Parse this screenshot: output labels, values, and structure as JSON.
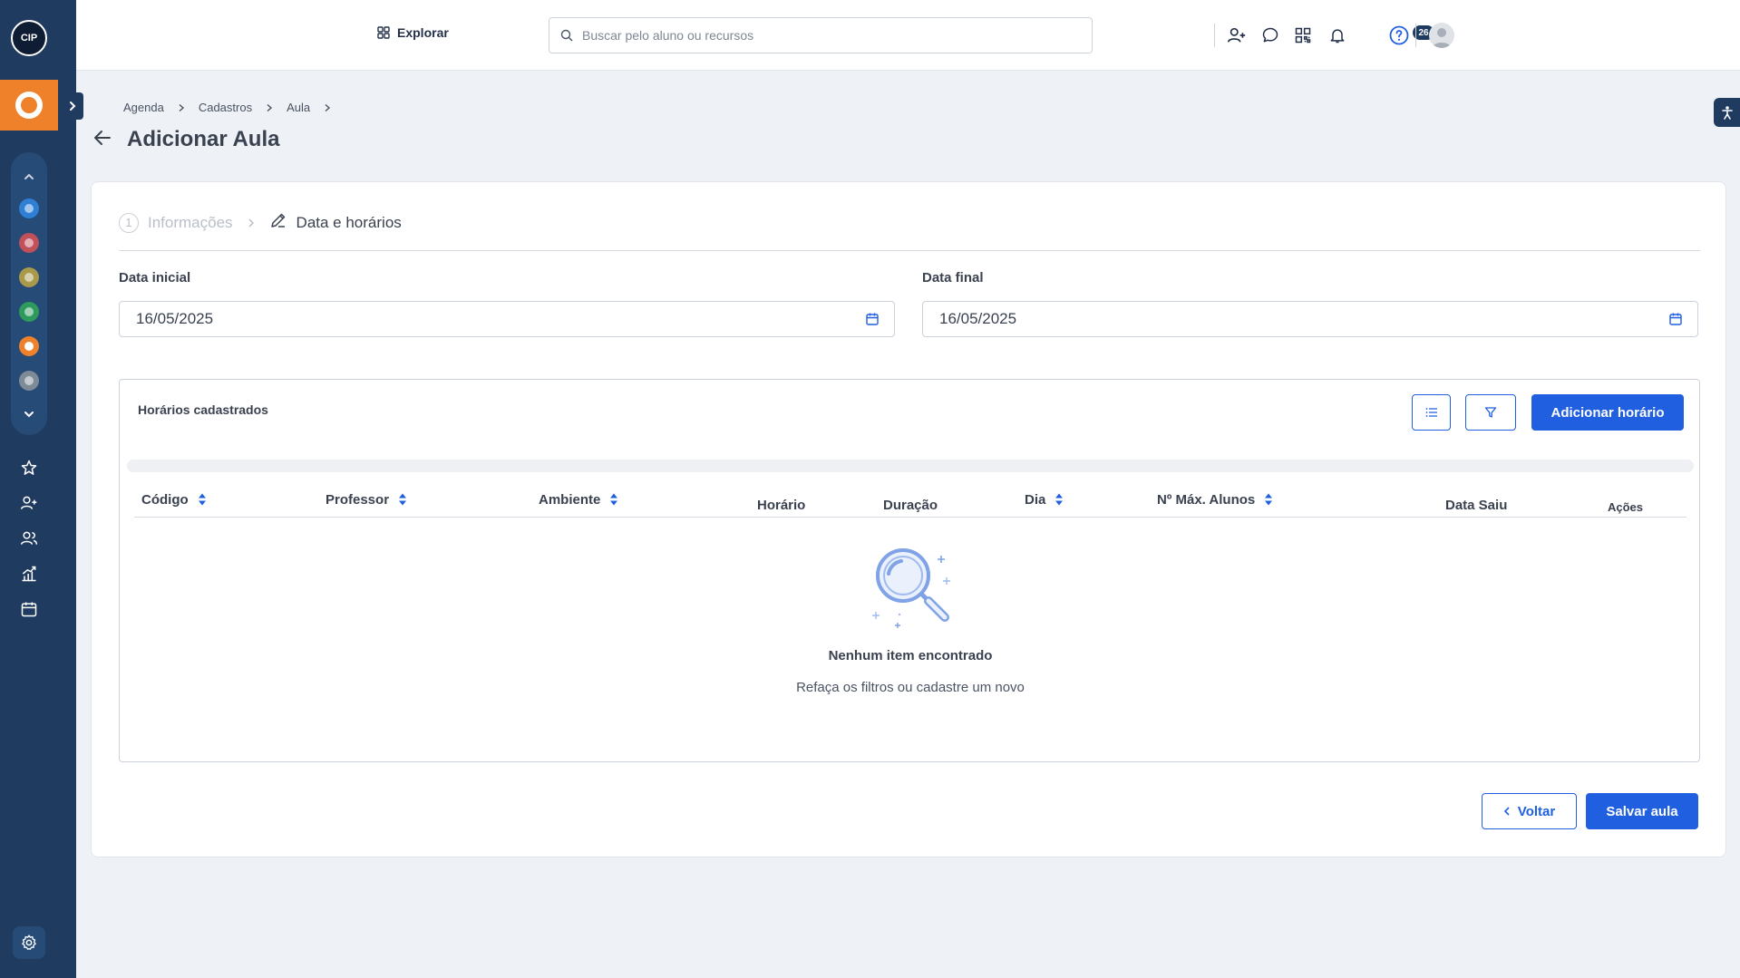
{
  "sidebar": {
    "logo_text": "CIP",
    "apps": [
      {
        "name": "app-blue",
        "color": "#2f7fd4"
      },
      {
        "name": "app-red",
        "color": "#c0505a"
      },
      {
        "name": "app-olive",
        "color": "#a89a4a"
      },
      {
        "name": "app-green",
        "color": "#2f9a5e"
      },
      {
        "name": "app-orange",
        "color": "#f0812b"
      },
      {
        "name": "app-gray",
        "color": "#7f8a99"
      }
    ],
    "nav_icons": [
      "star-icon",
      "add-user-icon",
      "users-icon",
      "chart-icon",
      "calendar-icon"
    ]
  },
  "topbar": {
    "explore_label": "Explorar",
    "search_placeholder": "Buscar pelo aluno ou recursos",
    "notification_count": "26"
  },
  "breadcrumb": [
    "Agenda",
    "Cadastros",
    "Aula"
  ],
  "page_title": "Adicionar Aula",
  "steps": {
    "step1_number": "1",
    "step1_label": "Informações",
    "step2_label": "Data e horários"
  },
  "form": {
    "start_label": "Data inicial",
    "start_value": "16/05/2025",
    "end_label": "Data final",
    "end_value": "16/05/2025"
  },
  "schedules": {
    "title": "Horários cadastrados",
    "add_label": "Adicionar horário",
    "columns": [
      "Código",
      "Professor",
      "Ambiente",
      "Horário",
      "Duração",
      "Dia",
      "Nº Máx. Alunos",
      "Data Saiu",
      "Ações"
    ],
    "empty_title": "Nenhum item encontrado",
    "empty_subtitle": "Refaça os filtros ou cadastre um novo"
  },
  "footer": {
    "back_label": "Voltar",
    "save_label": "Salvar aula"
  },
  "colors": {
    "primary": "#1f5fe0",
    "sidebar": "#1f3b60",
    "accent": "#f0812b"
  }
}
